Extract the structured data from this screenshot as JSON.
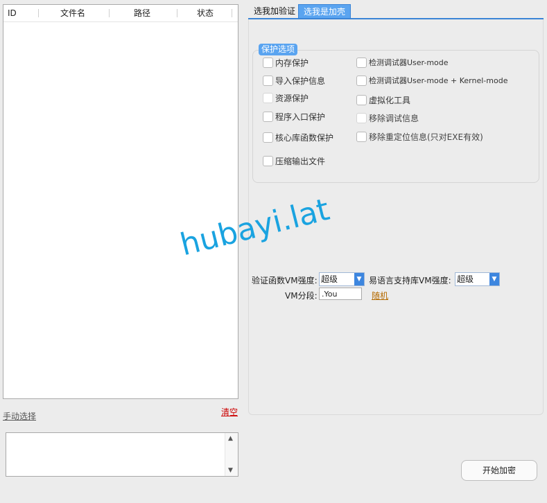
{
  "file_list": {
    "columns": [
      "ID",
      "文件名",
      "路径",
      "状态"
    ],
    "rows": []
  },
  "left_links": {
    "manual_select": "手动选择",
    "clear": "清空"
  },
  "log": {
    "text": ""
  },
  "tabs": [
    {
      "label": "选我加验证",
      "active": false
    },
    {
      "label": "选我是加壳",
      "active": true
    }
  ],
  "protect_group": {
    "title": "保护选项",
    "left_options": [
      {
        "label": "内存保护",
        "checked": false
      },
      {
        "label": "导入保护信息",
        "checked": false
      },
      {
        "label": "资源保护",
        "checked": false
      },
      {
        "label": "程序入口保护",
        "checked": false
      },
      {
        "label": "核心库函数保护",
        "checked": false
      },
      {
        "label": "压缩输出文件",
        "checked": false
      }
    ],
    "right_options": [
      {
        "label": "检测调试器User-mode",
        "checked": false
      },
      {
        "label": "检测调试器User-mode + Kernel-mode",
        "checked": false
      },
      {
        "label": "虚拟化工具",
        "checked": false
      },
      {
        "label": "移除调试信息",
        "checked": false
      },
      {
        "label": "移除重定位信息(只对EXE有效)",
        "checked": false
      }
    ]
  },
  "vm": {
    "verify_strength_label": "验证函数VM强度:",
    "verify_strength_value": "超级",
    "lib_strength_label": "易语言支持库VM强度:",
    "lib_strength_value": "超级",
    "segment_label": "VM分段:",
    "segment_value": ".You",
    "random_label": "随机"
  },
  "actions": {
    "start": "开始加密"
  },
  "watermark": "hubayi.lat",
  "colors": {
    "accent": "#3d86df",
    "tab_active": "#5aa4f0",
    "link_red": "#cc0000",
    "link_orange": "#b46a00",
    "watermark": "#1aa3e0"
  }
}
